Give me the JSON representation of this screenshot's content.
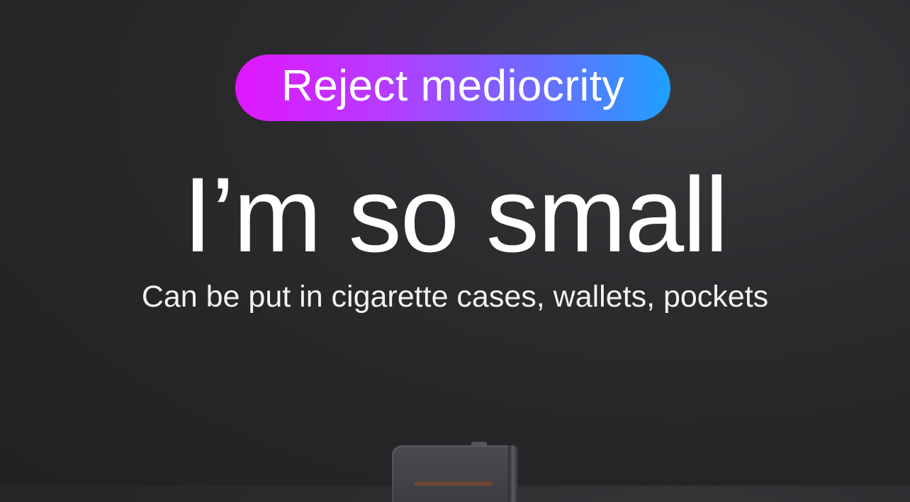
{
  "banner": {
    "label": "Reject mediocrity",
    "gradient_start": "#e117ff",
    "gradient_end": "#1fa0ff"
  },
  "headline": "I’m so small",
  "subline": "Can be put in cigarette cases, wallets, pockets",
  "colors": {
    "background": "#2a2a2d",
    "text": "#ffffff"
  }
}
